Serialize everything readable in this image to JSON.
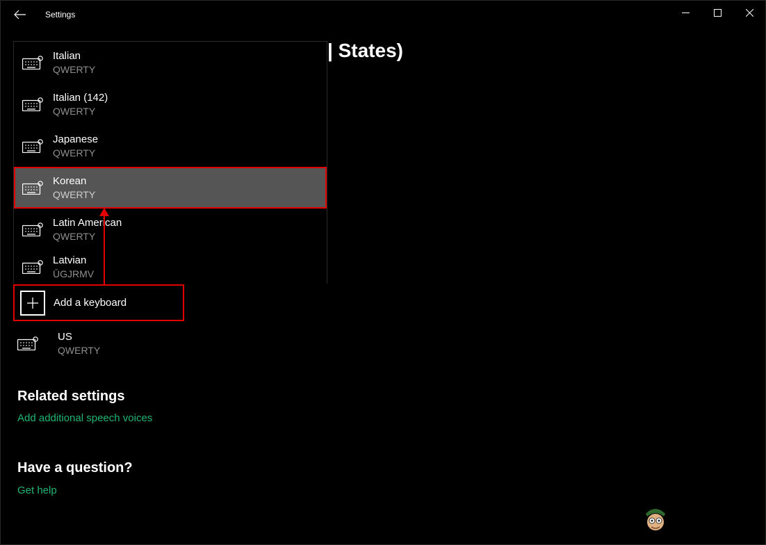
{
  "window": {
    "title": "Settings"
  },
  "heading_fragment": "| States)",
  "dropdown": {
    "items": [
      {
        "name": "Italian",
        "layout": "QWERTY"
      },
      {
        "name": "Italian (142)",
        "layout": "QWERTY"
      },
      {
        "name": "Japanese",
        "layout": "QWERTY"
      },
      {
        "name": "Korean",
        "layout": "QWERTY"
      },
      {
        "name": "Latin American",
        "layout": "QWERTY"
      },
      {
        "name": "Latvian",
        "layout": "ŪGJRMV"
      }
    ]
  },
  "add_keyboard_label": "Add a keyboard",
  "installed_keyboard": {
    "name": "US",
    "layout": "QWERTY"
  },
  "related": {
    "heading": "Related settings",
    "link": "Add additional speech voices"
  },
  "question": {
    "heading": "Have a question?",
    "link": "Get help"
  }
}
